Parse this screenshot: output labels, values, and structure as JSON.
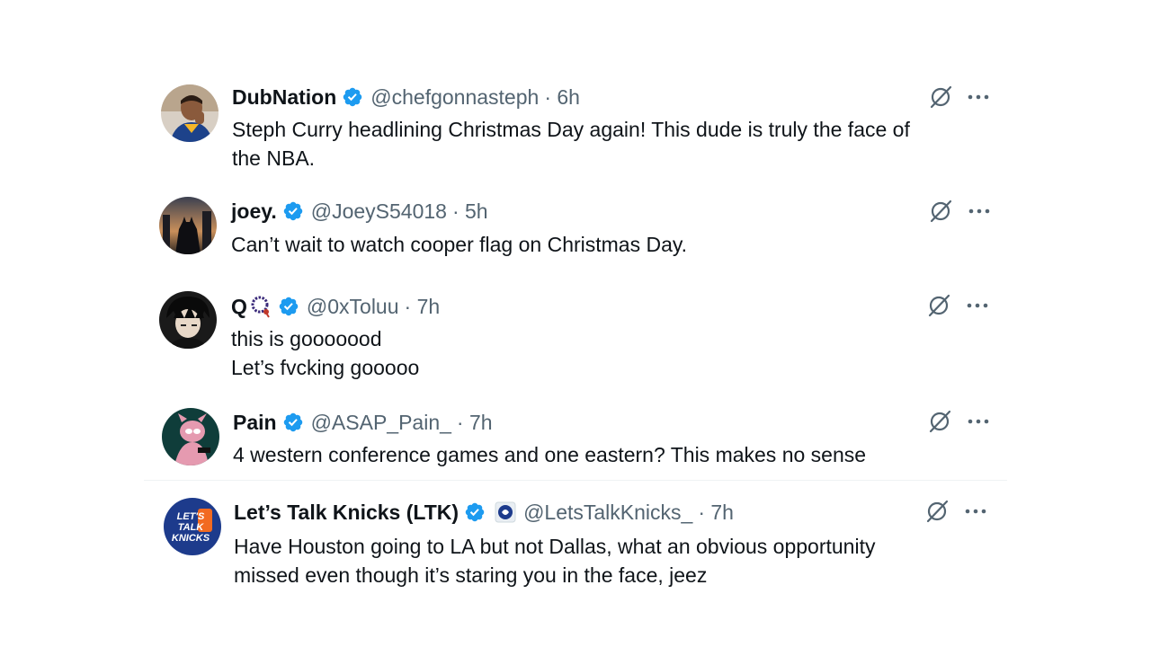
{
  "posts": [
    {
      "name": "DubNation",
      "handle": "@chefgonnasteph",
      "time": "· 6h",
      "lines": [
        "Steph Curry headlining Christmas Day again! This dude is truly the face of",
        "the NBA."
      ],
      "avatar_icon": "basketball-player-avatar-icon"
    },
    {
      "name": "joey.",
      "handle": "@JoeyS54018",
      "time": "· 5h",
      "lines": [
        "Can’t wait to watch cooper flag on Christmas Day."
      ],
      "avatar_icon": "batman-avatar-icon"
    },
    {
      "name": "Q",
      "handle": "@0xToluu",
      "time": "· 7h",
      "lines": [
        "this is gooooood",
        "Let’s fvcking gooooo"
      ],
      "avatar_icon": "anime-avatar-icon",
      "name_emoji": "prayer-beads-icon"
    },
    {
      "name": "Pain",
      "handle": "@ASAP_Pain_",
      "time": "· 7h",
      "lines": [
        "4 western conference games and one eastern? This makes no sense"
      ],
      "avatar_icon": "pink-panther-avatar-icon"
    },
    {
      "name": "Let’s Talk Knicks (LTK)",
      "handle": "@LetsTalkKnicks_",
      "time": "· 7h",
      "lines": [
        "Have Houston going to LA but not Dallas, what an obvious opportunity",
        "missed even though it’s staring you in the face, jeez"
      ],
      "avatar_icon": "knicks-logo-avatar-icon",
      "avatar_logo_lines": [
        "LET'S",
        "TALK",
        "KNICKS"
      ],
      "affiliate_icon": "affiliate-badge-icon"
    }
  ],
  "colors": {
    "verified": "#1d9bf0",
    "text": "#0f1419",
    "secondary": "#536471"
  }
}
